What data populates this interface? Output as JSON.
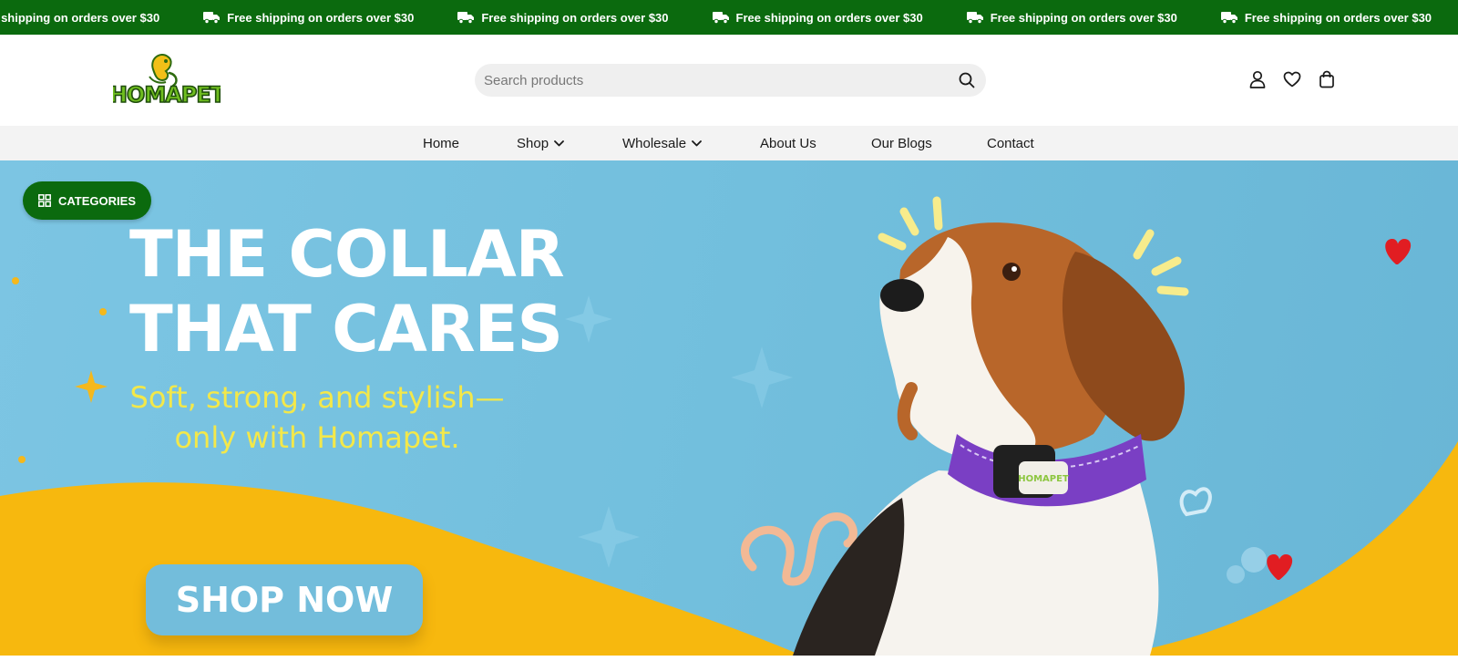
{
  "promo": {
    "message": "Free shipping on orders over $30",
    "items": [
      "Free shipping on orders over $30",
      "Free shipping on orders over $30",
      "Free shipping on orders over $30",
      "Free shipping on orders over $30",
      "Free shipping on orders over $30",
      "Free shipping on orders over $30"
    ],
    "icon": "truck-icon",
    "bg_color": "#0b6a0e"
  },
  "header": {
    "logo_text": "HOMAPET",
    "search": {
      "placeholder": "Search products",
      "value": ""
    },
    "icons": [
      "user-icon",
      "heart-icon",
      "bag-icon"
    ]
  },
  "nav": {
    "items": [
      {
        "label": "Home",
        "has_dropdown": false
      },
      {
        "label": "Shop",
        "has_dropdown": true
      },
      {
        "label": "Wholesale",
        "has_dropdown": true
      },
      {
        "label": "About Us",
        "has_dropdown": false
      },
      {
        "label": "Our Blogs",
        "has_dropdown": false
      },
      {
        "label": "Contact",
        "has_dropdown": false
      }
    ]
  },
  "hero": {
    "categories_label": "CATEGORIES",
    "title_line1": "THE COLLAR",
    "title_line2": "THAT CARES",
    "subtitle_line1": "Soft, strong, and stylish—",
    "subtitle_line2": "only with Homapet.",
    "cta_label": "SHOP NOW",
    "collar_tag_text": "HOMAPET",
    "colors": {
      "sky": "#74c0de",
      "wave": "#f7b80e",
      "title": "#ffffff",
      "subtitle": "#f3e84a",
      "accent_green": "#0b6a0e",
      "collar": "#7a3fc4"
    }
  }
}
